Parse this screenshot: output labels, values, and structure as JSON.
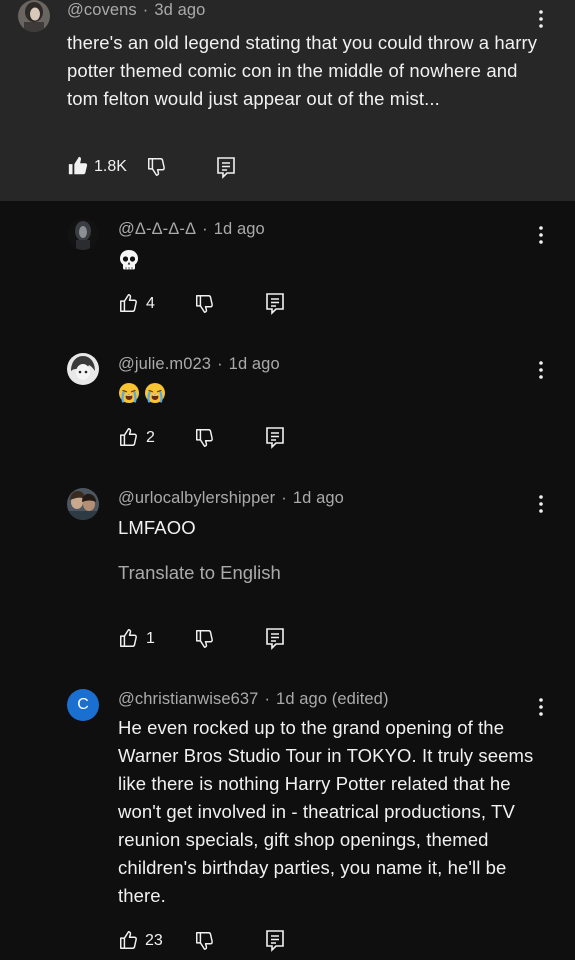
{
  "colors": {
    "background": "#0f0f0f",
    "highlighted_background": "#272727",
    "text_primary": "#f1f1f1",
    "text_secondary": "#aaaaaa",
    "avatar_c_blue": "#1a6fd1"
  },
  "parent_comment": {
    "author": "@covens",
    "separator": "·",
    "time": "3d ago",
    "text": "there's an old legend stating that you could throw a harry potter themed comic con in the middle of nowhere and tom felton would just appear out of the mist...",
    "likes": "1.8K",
    "liked": true
  },
  "replies": [
    {
      "author": "@Δ-Δ-Δ-Δ",
      "separator": "·",
      "time": "1d ago",
      "text": "",
      "emoji": [
        "skull"
      ],
      "likes": "4",
      "avatar_icon": "dark-hooded-figure"
    },
    {
      "author": "@julie.m023",
      "separator": "·",
      "time": "1d ago",
      "text": "",
      "emoji": [
        "loudly-crying-face",
        "loudly-crying-face"
      ],
      "likes": "2",
      "avatar_icon": "anime-character"
    },
    {
      "author": "@urlocalbylershipper",
      "separator": "·",
      "time": "1d ago",
      "text": "LMFAOO",
      "translate_label": "Translate to English",
      "likes": "1",
      "avatar_icon": "two-people-photo"
    },
    {
      "author": "@christianwise637",
      "separator": "·",
      "time": "1d ago (edited)",
      "text": "He even rocked up to the grand opening of the Warner Bros Studio Tour in TOKYO. It truly seems like there is nothing Harry Potter related that he won't get involved in - theatrical productions, TV reunion specials, gift shop openings, themed children's birthday parties, you name it, he'll be there.",
      "likes": "23",
      "avatar_letter": "C"
    }
  ],
  "icons": {
    "like": "thumbs-up-icon",
    "dislike": "thumbs-down-icon",
    "reply": "reply-comment-icon",
    "more": "more-vertical-icon"
  }
}
